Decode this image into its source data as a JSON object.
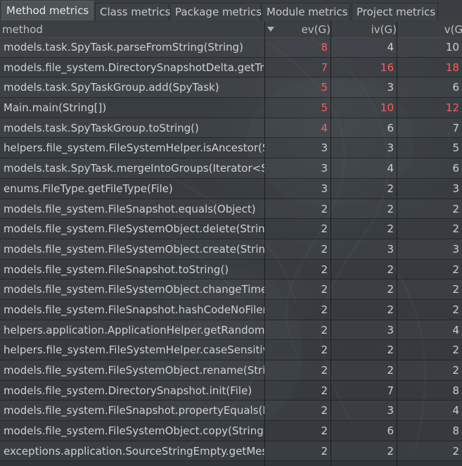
{
  "tabs": [
    {
      "label": "Method metrics",
      "active": true
    },
    {
      "label": "Class metrics",
      "active": false
    },
    {
      "label": "Package metrics",
      "active": false
    },
    {
      "label": "Module metrics",
      "active": false
    },
    {
      "label": "Project metrics",
      "active": false
    }
  ],
  "columns": {
    "method": "method",
    "ev": "ev(G)",
    "iv": "iv(G)",
    "v": "v(G)"
  },
  "sort_icon": "sort-descending-icon",
  "colors": {
    "highlight": "#ff5c5c",
    "text": "#d0d0d0"
  },
  "rows": [
    {
      "method": "models.task.SpyTask.parseFromString(String)",
      "ev": "8",
      "iv": "4",
      "v": "10",
      "ev_red": true,
      "iv_red": false,
      "v_red": false
    },
    {
      "method": "models.file_system.DirectorySnapshotDelta.getTrigg",
      "ev": "7",
      "iv": "16",
      "v": "18",
      "ev_red": true,
      "iv_red": true,
      "v_red": true
    },
    {
      "method": "models.task.SpyTaskGroup.add(SpyTask)",
      "ev": "5",
      "iv": "3",
      "v": "6",
      "ev_red": true,
      "iv_red": false,
      "v_red": false
    },
    {
      "method": "Main.main(String[])",
      "ev": "5",
      "iv": "10",
      "v": "12",
      "ev_red": true,
      "iv_red": true,
      "v_red": true
    },
    {
      "method": "models.task.SpyTaskGroup.toString()",
      "ev": "4",
      "iv": "6",
      "v": "7",
      "ev_red": true,
      "iv_red": false,
      "v_red": false
    },
    {
      "method": "helpers.file_system.FileSystemHelper.isAncestor(Str",
      "ev": "3",
      "iv": "3",
      "v": "5",
      "ev_red": false,
      "iv_red": false,
      "v_red": false
    },
    {
      "method": "models.task.SpyTask.mergeIntoGroups(Iterator<Spy",
      "ev": "3",
      "iv": "4",
      "v": "6",
      "ev_red": false,
      "iv_red": false,
      "v_red": false
    },
    {
      "method": "enums.FileType.getFileType(File)",
      "ev": "3",
      "iv": "2",
      "v": "3",
      "ev_red": false,
      "iv_red": false,
      "v_red": false
    },
    {
      "method": "models.file_system.FileSnapshot.equals(Object)",
      "ev": "2",
      "iv": "2",
      "v": "2",
      "ev_red": false,
      "iv_red": false,
      "v_red": false
    },
    {
      "method": "models.file_system.FileSystemObject.delete(String)",
      "ev": "2",
      "iv": "2",
      "v": "2",
      "ev_red": false,
      "iv_red": false,
      "v_red": false
    },
    {
      "method": "models.file_system.FileSystemObject.create(String)",
      "ev": "2",
      "iv": "3",
      "v": "3",
      "ev_red": false,
      "iv_red": false,
      "v_red": false
    },
    {
      "method": "models.file_system.FileSnapshot.toString()",
      "ev": "2",
      "iv": "2",
      "v": "2",
      "ev_red": false,
      "iv_red": false,
      "v_red": false
    },
    {
      "method": "models.file_system.FileSystemObject.changeTime(S",
      "ev": "2",
      "iv": "2",
      "v": "2",
      "ev_red": false,
      "iv_red": false,
      "v_red": false
    },
    {
      "method": "models.file_system.FileSnapshot.hashCodeNoFilena",
      "ev": "2",
      "iv": "2",
      "v": "2",
      "ev_red": false,
      "iv_red": false,
      "v_red": false
    },
    {
      "method": "helpers.application.ApplicationHelper.getRandomS",
      "ev": "2",
      "iv": "3",
      "v": "4",
      "ev_red": false,
      "iv_red": false,
      "v_red": false
    },
    {
      "method": "helpers.file_system.FileSystemHelper.caseSensitive",
      "ev": "2",
      "iv": "2",
      "v": "2",
      "ev_red": false,
      "iv_red": false,
      "v_red": false
    },
    {
      "method": "models.file_system.FileSystemObject.rename(String",
      "ev": "2",
      "iv": "2",
      "v": "2",
      "ev_red": false,
      "iv_red": false,
      "v_red": false
    },
    {
      "method": "models.file_system.DirectorySnapshot.init(File)",
      "ev": "2",
      "iv": "7",
      "v": "8",
      "ev_red": false,
      "iv_red": false,
      "v_red": false
    },
    {
      "method": "models.file_system.FileSnapshot.propertyEquals(Fil",
      "ev": "2",
      "iv": "3",
      "v": "4",
      "ev_red": false,
      "iv_red": false,
      "v_red": false
    },
    {
      "method": "models.file_system.FileSystemObject.copy(String,St",
      "ev": "2",
      "iv": "6",
      "v": "8",
      "ev_red": false,
      "iv_red": false,
      "v_red": false
    },
    {
      "method": "exceptions.application.SourceStringEmpty.getMess",
      "ev": "2",
      "iv": "2",
      "v": "2",
      "ev_red": false,
      "iv_red": false,
      "v_red": false
    }
  ]
}
